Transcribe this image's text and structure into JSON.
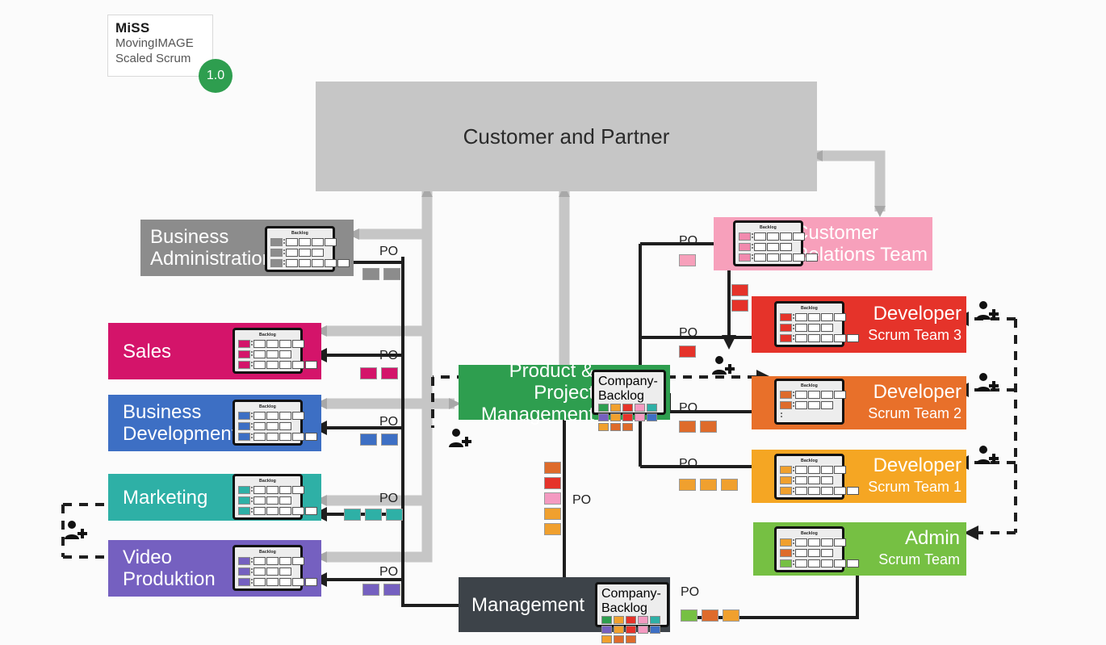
{
  "logo": {
    "name": "MiSS",
    "line2": "MovingIMAGE",
    "line3": "Scaled Scrum",
    "version": "1.0",
    "badge_color": "#2e9e4f"
  },
  "labels": {
    "po": "PO",
    "backlog": "Backlog",
    "company_backlog": "Company-Backlog"
  },
  "customer": {
    "title": "Customer and Partner",
    "color": "#c6c6c6"
  },
  "departments": [
    {
      "id": "business-administration",
      "title": "Business\nAdministration",
      "line1": "Business",
      "line2": "Administration",
      "color": "#8c8c8c",
      "board_rows": [
        4,
        3,
        5
      ],
      "po_label": "PO",
      "po_chips": 2,
      "po_chip_color": "#8c8c8c"
    },
    {
      "id": "sales",
      "title": "Sales",
      "line1": "Sales",
      "line2": "",
      "color": "#d4146a",
      "board_rows": [
        4,
        3,
        5
      ],
      "po_label": "PO",
      "po_chips": 2,
      "po_chip_color": "#d4146a"
    },
    {
      "id": "business-development",
      "title": "Business Development",
      "line1": "Business",
      "line2": "Development",
      "color": "#3d6fc4",
      "board_rows": [
        4,
        3,
        5
      ],
      "po_label": "PO",
      "po_chips": 2,
      "po_chip_color": "#3d6fc4"
    },
    {
      "id": "marketing",
      "title": "Marketing",
      "line1": "Marketing",
      "line2": "",
      "color": "#2eb0a6",
      "board_rows": [
        4,
        3,
        5
      ],
      "po_label": "PO",
      "po_chips": 3,
      "po_chip_color": "#2eb0a6"
    },
    {
      "id": "video-produktion",
      "title": "Video Produktion",
      "line1": "Video",
      "line2": "Produktion",
      "color": "#7560c0",
      "board_rows": [
        4,
        3,
        5
      ],
      "po_label": "PO",
      "po_chips": 2,
      "po_chip_color": "#7560c0"
    }
  ],
  "center": [
    {
      "id": "product-project-management",
      "line1": "Product & Project",
      "line2": "Management",
      "color": "#2e9e4f",
      "company_backlog": [
        "#2e9e4f",
        "#f0a02e",
        "#e5332a",
        "#f49ac1",
        "#2eb0a6",
        "#7560c0",
        "#f0a02e",
        "#e5332a",
        "#f49ac1",
        "#3d6fc4",
        "#f0a02e",
        "#de6b2b",
        "#de6b2b"
      ],
      "po_label": "PO",
      "po_chips_vertical": [
        "#de6b2b",
        "#e5332a",
        "#f49ac1",
        "#f0a02e",
        "#f0a02e"
      ]
    },
    {
      "id": "management",
      "line1": "Management",
      "line2": "",
      "color": "#3d4349",
      "company_backlog": [
        "#2e9e4f",
        "#f0a02e",
        "#e5332a",
        "#f49ac1",
        "#2eb0a6",
        "#7560c0",
        "#f0a02e",
        "#e5332a",
        "#f49ac1",
        "#3d6fc4",
        "#f0a02e",
        "#de6b2b",
        "#de6b2b"
      ],
      "po_label": "PO",
      "po_chips": [
        "#76c043",
        "#de6b2b",
        "#f0a02e"
      ]
    }
  ],
  "teams": [
    {
      "id": "customer-relations-team",
      "line1": "Customer",
      "line2": "Relations Team",
      "color": "#f7a0bb",
      "board_rows": [
        4,
        3,
        5
      ],
      "po_label": "PO",
      "po_chips": [
        "#f7a0bb"
      ],
      "has_person_icon": false
    },
    {
      "id": "developer-scrum-team-3",
      "line1": "Developer",
      "line2": "Scrum Team 3",
      "color": "#e5332a",
      "board_rows": [
        4,
        3,
        5
      ],
      "po_label": "PO",
      "po_chips": [
        "#e5332a"
      ],
      "extra_chips": [
        "#e5332a",
        "#e5332a"
      ],
      "has_person_icon": true
    },
    {
      "id": "developer-scrum-team-2",
      "line1": "Developer",
      "line2": "Scrum Team 2",
      "color": "#e8702a",
      "board_rows": [
        4,
        3
      ],
      "po_label": "PO",
      "po_chips": [
        "#de6b2b",
        "#de6b2b"
      ],
      "has_person_icon": true
    },
    {
      "id": "developer-scrum-team-1",
      "line1": "Developer",
      "line2": "Scrum Team 1",
      "color": "#f5a623",
      "board_rows": [
        4,
        3,
        5
      ],
      "po_label": "PO",
      "po_chips": [
        "#f0a02e",
        "#f0a02e",
        "#f0a02e"
      ],
      "has_person_icon": true
    },
    {
      "id": "admin-scrum-team",
      "line1": "Admin",
      "line2": "Scrum Team",
      "color": "#76c043",
      "board_rows": [
        4,
        3,
        5
      ],
      "board_chip_colors": [
        "#f0a02e",
        "#de6b2b",
        "#76c043"
      ],
      "has_person_icon": false
    }
  ],
  "icons": {
    "person_add": "person-add-icon"
  }
}
